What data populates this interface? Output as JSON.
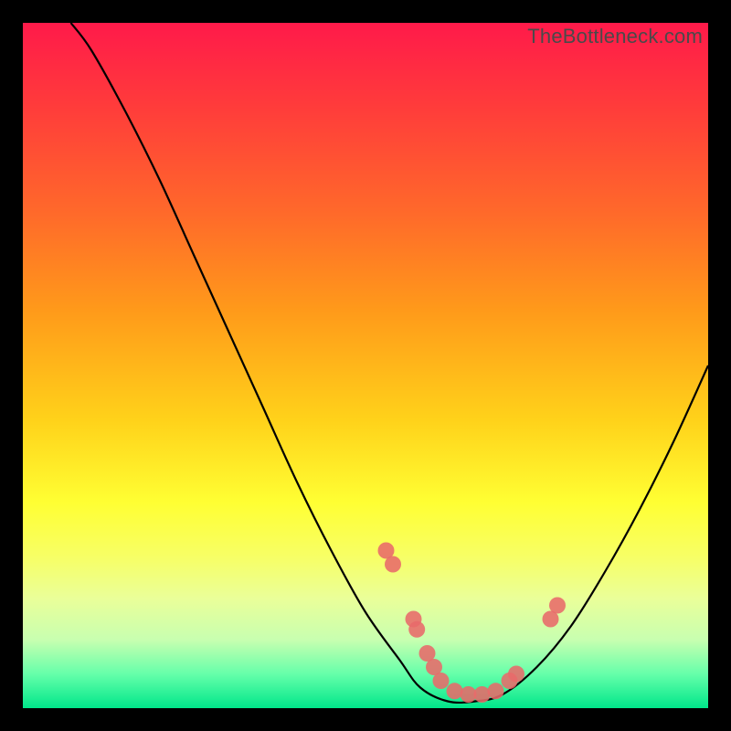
{
  "watermark": "TheBottleneck.com",
  "chart_data": {
    "type": "line",
    "title": "",
    "xlabel": "",
    "ylabel": "",
    "xlim": [
      0,
      100
    ],
    "ylim": [
      0,
      100
    ],
    "curve": {
      "name": "bottleneck-curve",
      "points_xy": [
        [
          7,
          100
        ],
        [
          10,
          96
        ],
        [
          15,
          87
        ],
        [
          20,
          77
        ],
        [
          25,
          66
        ],
        [
          30,
          55
        ],
        [
          35,
          44
        ],
        [
          40,
          33
        ],
        [
          45,
          23
        ],
        [
          50,
          14
        ],
        [
          55,
          7
        ],
        [
          58,
          3
        ],
        [
          62,
          1
        ],
        [
          66,
          1
        ],
        [
          70,
          2
        ],
        [
          75,
          6
        ],
        [
          80,
          12
        ],
        [
          85,
          20
        ],
        [
          90,
          29
        ],
        [
          95,
          39
        ],
        [
          100,
          50
        ]
      ]
    },
    "markers": {
      "name": "highlighted-points",
      "color": "#e86a6a",
      "points_xy": [
        [
          53,
          23
        ],
        [
          54,
          21
        ],
        [
          57,
          13
        ],
        [
          57.5,
          11.5
        ],
        [
          59,
          8
        ],
        [
          60,
          6
        ],
        [
          61,
          4
        ],
        [
          63,
          2.5
        ],
        [
          65,
          2
        ],
        [
          67,
          2
        ],
        [
          69,
          2.5
        ],
        [
          71,
          4
        ],
        [
          72,
          5
        ],
        [
          77,
          13
        ],
        [
          78,
          15
        ]
      ]
    }
  }
}
